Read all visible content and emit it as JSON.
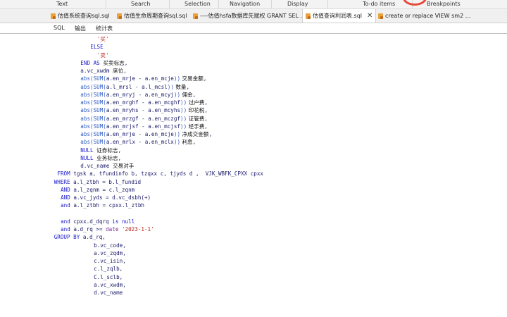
{
  "top_menu": [
    "Text",
    "Search",
    "Selection",
    "Navigation",
    "Display",
    "To-do items",
    "Breakpoints"
  ],
  "file_tabs": [
    {
      "label": "估值系统查询sql.sql",
      "active": false
    },
    {
      "label": "估值生命周期查询sql.sql",
      "active": false
    },
    {
      "label": "----估值hsfa数据库先赋权 GRANT SEL ...",
      "active": false
    },
    {
      "label": "估值查询利润表.sql",
      "active": true
    },
    {
      "label": "create or replace VIEW sm2 ...",
      "active": false
    }
  ],
  "close_glyph": "✕",
  "sub_tabs": [
    "SQL",
    "输出",
    "统计表"
  ],
  "code": [
    {
      "indent": 14,
      "parts": [
        [
          "str",
          "'买'"
        ]
      ]
    },
    {
      "indent": 12,
      "parts": [
        [
          "kw",
          "ELSE"
        ]
      ]
    },
    {
      "indent": 14,
      "parts": [
        [
          "str",
          "'卖'"
        ]
      ]
    },
    {
      "indent": 9,
      "parts": [
        [
          "kw",
          "END AS "
        ],
        [
          "cmt",
          "买卖标志"
        ],
        [
          "id",
          ","
        ]
      ]
    },
    {
      "indent": 9,
      "parts": [
        [
          "id",
          "a.vc_xwdm "
        ],
        [
          "cmt",
          "席位"
        ],
        [
          "id",
          ","
        ]
      ]
    },
    {
      "indent": 9,
      "parts": [
        [
          "fn",
          "abs(SUM("
        ],
        [
          "id",
          "a.en_mrje - a.en_mcje"
        ],
        [
          "fn",
          "))"
        ],
        [
          "cmt",
          " 交易金额"
        ],
        [
          "id",
          ","
        ]
      ]
    },
    {
      "indent": 9,
      "parts": [
        [
          "fn",
          "abs(SUM("
        ],
        [
          "id",
          "a.l_mrsl - a.l_mcsl"
        ],
        [
          "fn",
          "))"
        ],
        [
          "cmt",
          " 数量"
        ],
        [
          "id",
          ","
        ]
      ]
    },
    {
      "indent": 9,
      "parts": [
        [
          "fn",
          "abs(SUM("
        ],
        [
          "id",
          "a.en_mryj - a.en_mcyj"
        ],
        [
          "fn",
          "))"
        ],
        [
          "cmt",
          " 佣金"
        ],
        [
          "id",
          ","
        ]
      ]
    },
    {
      "indent": 9,
      "parts": [
        [
          "fn",
          "abs(SUM("
        ],
        [
          "id",
          "a.en_mrghf - a.en_mcghf"
        ],
        [
          "fn",
          "))"
        ],
        [
          "cmt",
          " 过户费"
        ],
        [
          "id",
          ","
        ]
      ]
    },
    {
      "indent": 9,
      "parts": [
        [
          "fn",
          "abs(SUM("
        ],
        [
          "id",
          "a.en_mryhs - a.en_mcyhs"
        ],
        [
          "fn",
          "))"
        ],
        [
          "cmt",
          " 印花税"
        ],
        [
          "id",
          ","
        ]
      ]
    },
    {
      "indent": 9,
      "parts": [
        [
          "fn",
          "abs(SUM("
        ],
        [
          "id",
          "a.en_mrzgf - a.en_mczgf"
        ],
        [
          "fn",
          "))"
        ],
        [
          "cmt",
          " 证管费"
        ],
        [
          "id",
          ","
        ]
      ]
    },
    {
      "indent": 9,
      "parts": [
        [
          "fn",
          "abs(SUM("
        ],
        [
          "id",
          "a.en_mrjsf - a.en_mcjsf"
        ],
        [
          "fn",
          "))"
        ],
        [
          "cmt",
          " 经手费"
        ],
        [
          "id",
          ","
        ]
      ]
    },
    {
      "indent": 9,
      "parts": [
        [
          "fn",
          "abs(SUM("
        ],
        [
          "id",
          "a.en_mrje - a.en_mcje"
        ],
        [
          "fn",
          "))"
        ],
        [
          "cmt",
          " 净成交金额"
        ],
        [
          "id",
          ","
        ]
      ]
    },
    {
      "indent": 9,
      "parts": [
        [
          "fn",
          "abs(SUM("
        ],
        [
          "id",
          "a.en_mrlx - a.en_mclx"
        ],
        [
          "fn",
          "))"
        ],
        [
          "cmt",
          " 利息"
        ],
        [
          "id",
          ","
        ]
      ]
    },
    {
      "indent": 9,
      "parts": [
        [
          "kw",
          "NULL "
        ],
        [
          "cmt",
          "证券标志"
        ],
        [
          "id",
          ","
        ]
      ]
    },
    {
      "indent": 9,
      "parts": [
        [
          "kw",
          "NULL "
        ],
        [
          "cmt",
          "业务标志"
        ],
        [
          "id",
          ","
        ]
      ]
    },
    {
      "indent": 9,
      "parts": [
        [
          "id",
          "d.vc_name "
        ],
        [
          "cmt",
          "交易对手"
        ]
      ]
    },
    {
      "indent": 2,
      "parts": [
        [
          "kw",
          "FROM "
        ],
        [
          "id",
          "tgsk a, tfundinfo b, tzqxx c, tjyds d ,  VJK_WBFK_CPXX cpxx"
        ]
      ]
    },
    {
      "indent": 1,
      "parts": [
        [
          "kw",
          "WHERE "
        ],
        [
          "id",
          "a.l_ztbh = b.l_fundid"
        ]
      ]
    },
    {
      "indent": 3,
      "parts": [
        [
          "kw",
          "AND "
        ],
        [
          "id",
          "a.l_zqnm = c.l_zqnm"
        ]
      ]
    },
    {
      "indent": 3,
      "parts": [
        [
          "kw",
          "AND "
        ],
        [
          "id",
          "a.vc_jyds = d.vc_dsbh(+)"
        ]
      ]
    },
    {
      "indent": 3,
      "parts": [
        [
          "kw",
          "and "
        ],
        [
          "id",
          "a.l_ztbh = cpxx.l_ztbh"
        ]
      ]
    },
    {
      "indent": 0,
      "parts": []
    },
    {
      "indent": 3,
      "parts": [
        [
          "kw",
          "and "
        ],
        [
          "id",
          "cpxx.d_dqrq "
        ],
        [
          "kw",
          "is null"
        ]
      ]
    },
    {
      "indent": 3,
      "parts": [
        [
          "kw",
          "and "
        ],
        [
          "id",
          "a.d_rq >= "
        ],
        [
          "dat",
          "date "
        ],
        [
          "str",
          "'2023-1-1'"
        ]
      ]
    },
    {
      "indent": 1,
      "parts": [
        [
          "kw",
          "GROUP BY "
        ],
        [
          "id",
          "a.d_rq,"
        ]
      ]
    },
    {
      "indent": 13,
      "parts": [
        [
          "id",
          "b.vc_code,"
        ]
      ]
    },
    {
      "indent": 13,
      "parts": [
        [
          "id",
          "a.vc_zqdm,"
        ]
      ]
    },
    {
      "indent": 13,
      "parts": [
        [
          "id",
          "c.vc_isin,"
        ]
      ]
    },
    {
      "indent": 13,
      "parts": [
        [
          "id",
          "c.l_zqlb,"
        ]
      ]
    },
    {
      "indent": 13,
      "parts": [
        [
          "id",
          "C.l_sclb,"
        ]
      ]
    },
    {
      "indent": 13,
      "parts": [
        [
          "id",
          "a.vc_xwdm,"
        ]
      ]
    },
    {
      "indent": 13,
      "parts": [
        [
          "id",
          "d.vc_name"
        ]
      ]
    }
  ]
}
